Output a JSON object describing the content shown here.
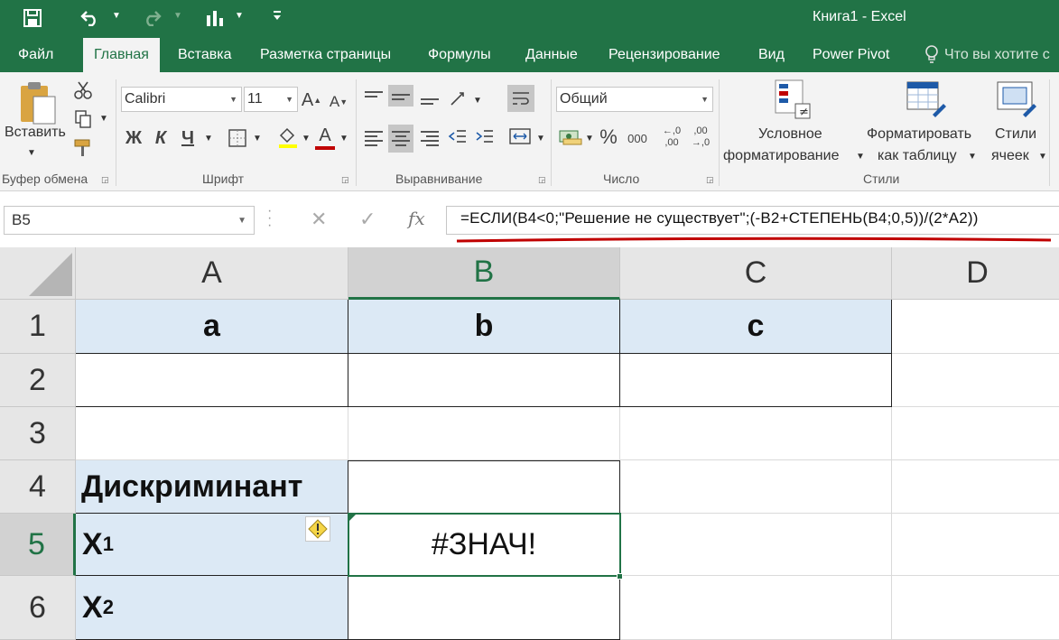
{
  "window": {
    "title": "Книга1 - Excel"
  },
  "quick_access": {
    "save_icon": "save-icon",
    "undo_icon": "undo-icon",
    "redo_icon": "redo-icon",
    "chart_icon": "chart-icon",
    "customize_icon": "customize-icon"
  },
  "tabs": [
    {
      "label": "Файл",
      "active": false
    },
    {
      "label": "Главная",
      "active": true
    },
    {
      "label": "Вставка",
      "active": false
    },
    {
      "label": "Разметка страницы",
      "active": false
    },
    {
      "label": "Формулы",
      "active": false
    },
    {
      "label": "Данные",
      "active": false
    },
    {
      "label": "Рецензирование",
      "active": false
    },
    {
      "label": "Вид",
      "active": false
    },
    {
      "label": "Power Pivot",
      "active": false
    }
  ],
  "tell_me": {
    "placeholder": "Что вы хотите с"
  },
  "ribbon": {
    "clipboard": {
      "label": "Буфер обмена",
      "paste_label": "Вставить"
    },
    "font": {
      "label": "Шрифт",
      "font_name": "Calibri",
      "font_size": "11",
      "bold": "Ж",
      "italic": "К",
      "underline": "Ч",
      "grow_font": "A",
      "shrink_font": "A",
      "font_color": "A"
    },
    "alignment": {
      "label": "Выравнивание"
    },
    "number": {
      "label": "Число",
      "format": "Общий",
      "percent": "%",
      "thousands": "000",
      "inc_decimal_top": "←,0",
      "inc_decimal_bottom": ",00",
      "dec_decimal_top": ",00",
      "dec_decimal_bottom": "→,0"
    },
    "styles": {
      "label": "Стили",
      "conditional_line1": "Условное",
      "conditional_line2": "форматирование",
      "format_table_line1": "Форматировать",
      "format_table_line2": "как таблицу",
      "cell_styles_line1": "Стили",
      "cell_styles_line2": "ячеек"
    }
  },
  "formula_bar": {
    "name_box": "B5",
    "cancel": "✕",
    "enter": "✓",
    "fx": "fx",
    "formula": "=ЕСЛИ(B4<0;\"Решение не существует\";(-B2+СТЕПЕНЬ(B4;0,5))/(2*A2))"
  },
  "grid": {
    "columns": [
      "A",
      "B",
      "C",
      "D"
    ],
    "selected_column": "B",
    "rows": [
      "1",
      "2",
      "3",
      "4",
      "5",
      "6"
    ],
    "selected_row": "5",
    "cells": {
      "A1": "a",
      "B1": "b",
      "C1": "c",
      "A4": "Дискриминант",
      "A5_main": "X",
      "A5_sub": "1",
      "A6_main": "X",
      "A6_sub": "2",
      "B5": "#ЗНАЧ!"
    },
    "colors": {
      "excel_green": "#217346",
      "header_fill": "#dce9f5",
      "formula_underline": "#c00000"
    }
  }
}
